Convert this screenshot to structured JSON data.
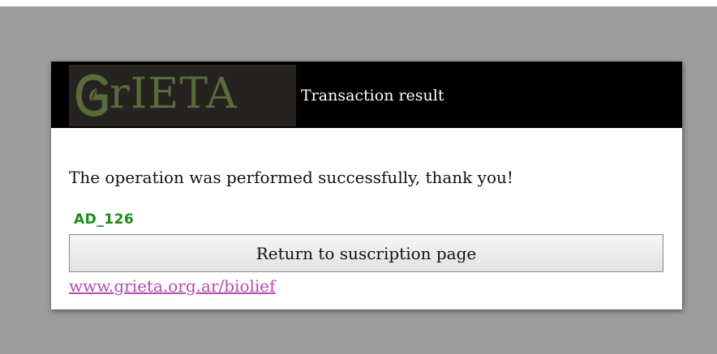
{
  "header": {
    "logo_text": "rIETA",
    "title": "Transaction result"
  },
  "main": {
    "message": "The operation was performed successfully, thank you!",
    "code": "AD_126",
    "return_button_label": "Return to suscription page",
    "link_text": "www.grieta.org.ar/biolief"
  },
  "colors": {
    "page_background": "#9c9c9c",
    "header_background": "#000000",
    "logo_background": "#262220",
    "logo_green": "#5a6b3a",
    "code_green": "#1a8a1a",
    "link_color": "#b44bb0"
  },
  "icons": {
    "logo_mark": "leaf-g-logo-icon"
  }
}
